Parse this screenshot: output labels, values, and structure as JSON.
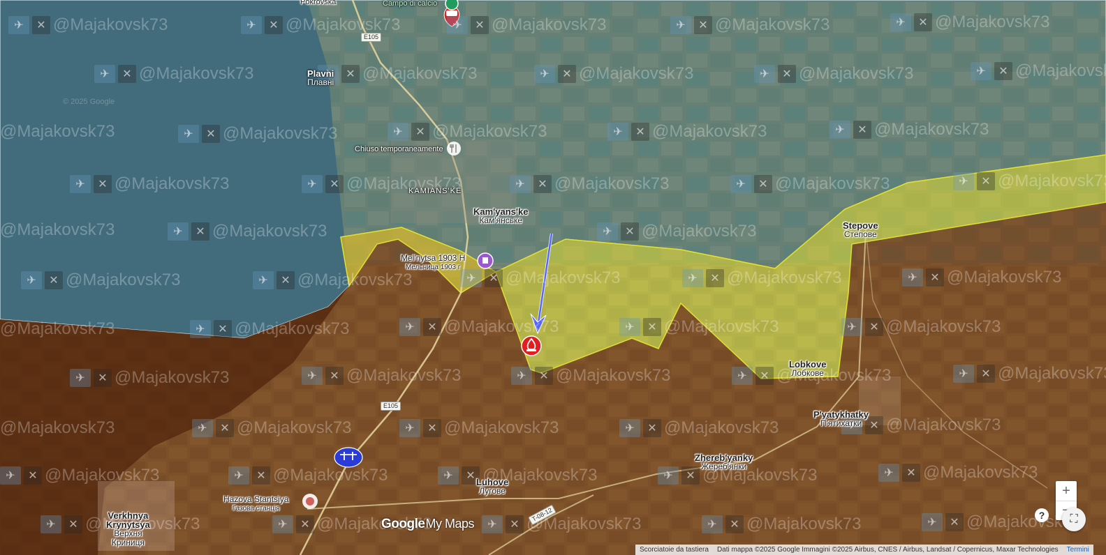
{
  "places": {
    "pokrovska": "Pokrovska",
    "campo": "Campo di calcio",
    "plavni_en": "Plavni",
    "plavni_uk": "Плавні",
    "chiuso": "Chiuso temporaneamente",
    "kamianske_upper": "KAMIANS'KE",
    "kamianske_en": "Kam'yans'ke",
    "kamianske_uk": "Кам'янське",
    "melnytsa_en": "Mel'nytsa 1903 H",
    "melnytsa_uk": "Мельница 1903 г",
    "stepove_en": "Stepove",
    "stepove_uk": "Степове",
    "lobkove_en": "Lobkove",
    "lobkove_uk": "Лобкове",
    "pyatykhatky_en": "P'yatykhatky",
    "pyatykhatky_uk": "П'ятихатки",
    "zherebyanky_en": "Zhereb'yanky",
    "zherebyanky_uk": "Жереб'янки",
    "luhove_en": "Luhove",
    "luhove_uk": "Лугове",
    "hazova_en": "Hazova Stantsiya",
    "hazova_uk": "Газова станція",
    "verkh_en1": "Verkhnya",
    "verkh_en2": "Krynytsya",
    "verkh_uk1": "Верхня",
    "verkh_uk2": "Криниця"
  },
  "roads": {
    "e105_top": "E105",
    "e105_bottom": "E105",
    "t0812": "T-08-12"
  },
  "watermark": {
    "handle": "@Majakovsk73",
    "copyright": "© 2025 Google"
  },
  "logo": {
    "google": "Google",
    "mymaps": "My Maps"
  },
  "controls": {
    "zoom_in": "+",
    "zoom_out": "−",
    "help": "?",
    "fullscreen": "⛶"
  },
  "attribution": {
    "keyboard": "Scorciatoie da tastiera",
    "data": "Dati mappa ©2025 Google Immagini ©2025 Airbus, CNES / Airbus, Landsat / Copernicus, Maxar Technologies",
    "terms": "Termini"
  },
  "colors": {
    "water_overlay": "#9ec9e0",
    "russian_zone": "#8a3a10",
    "contested_zone": "#e8e84a",
    "ukraine_zone": "#7fb8d4",
    "attack_arrow": "#5566ff",
    "marker_red": "#e02020",
    "marker_blue": "#2b3bd6"
  },
  "markers": {
    "fire_icon": "fire-marker-icon",
    "drone_icon": "drone-marker-icon",
    "red_top_icon": "vehicle-marker-icon"
  }
}
